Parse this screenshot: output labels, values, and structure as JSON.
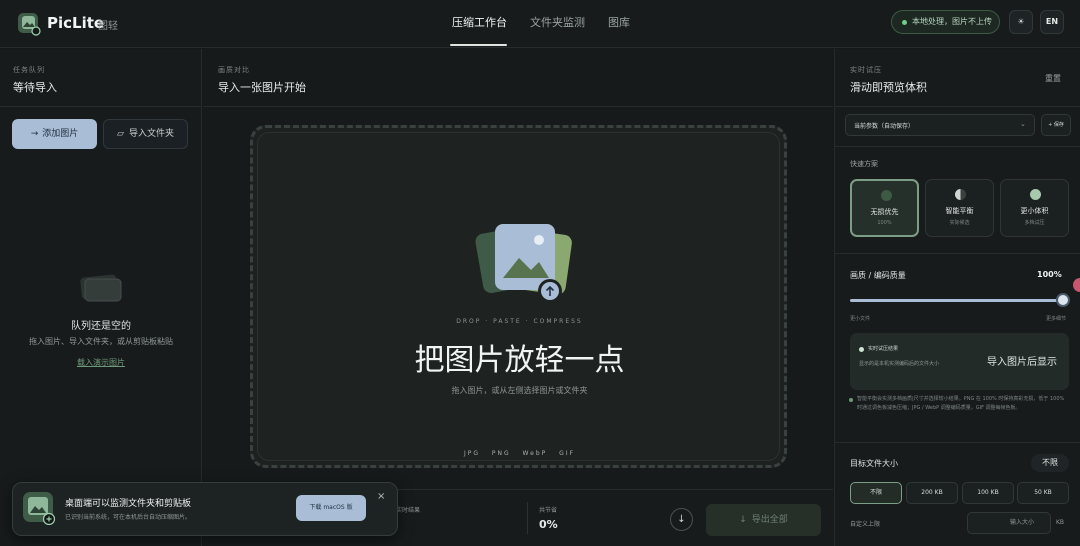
{
  "header": {
    "brand": "PicLite",
    "brand_sub": "图轻",
    "nav": [
      "压缩工作台",
      "文件夹监测",
      "图库"
    ],
    "local_badge": "本地处理，图片不上传",
    "theme_icon": "sun-icon",
    "theme_glyph": "☀",
    "lang": "EN"
  },
  "left": {
    "section_label": "任务队列",
    "title": "等待导入",
    "add_label": "添加图片",
    "folder_label": "导入文件夹",
    "empty_title": "队列还是空的",
    "empty_desc": "拖入图片、导入文件夹，或从剪贴板粘贴",
    "demo_link": "载入演示图片"
  },
  "center": {
    "section_label": "画质对比",
    "title": "导入一张图片开始",
    "drop_caption": "DROP · PASTE · COMPRESS",
    "drop_title": "把图片放轻一点",
    "drop_hint": "拖入图片，或从左侧选择图片或文件夹",
    "formats": "JPG PNG WebP GIF",
    "realtime_result": "实时结果",
    "saved_label": "共节省",
    "saved_value": "0%",
    "export_label": "导出全部"
  },
  "toast": {
    "title": "桌面端可以监测文件夹和剪贴板",
    "desc": "已识别当前系统，可在本机后台自动压缩图片。",
    "button": "下载 macOS 版",
    "close": "×"
  },
  "right": {
    "section_label": "实时试压",
    "title": "滑动即预览体积",
    "reset": "重置",
    "preset_value": "当前参数（自动保存）",
    "save_preset": "+ 保存",
    "quick_label": "快速方案",
    "presets": [
      {
        "title": "无损优先",
        "sub": "100%",
        "color": "#3d5a44"
      },
      {
        "title": "智能平衡",
        "sub": "实际候选",
        "color": "#cfd6d2"
      },
      {
        "title": "更小体积",
        "sub": "多档试压",
        "color": "#a7c9ae"
      }
    ],
    "quality_label": "画质 / 编码质量",
    "quality_value": "100%",
    "quality_fraction": 1.0,
    "slider_min": "更小文件",
    "slider_max": "更多细节",
    "preview_label": "实时试压结果",
    "preview_desc": "显示的是本机实测编码后的文件大小",
    "preview_hint": "导入图片后显示",
    "note": "智能平衡会实测多档画质|尺寸并选择较小结果。PNG 在 100% 时保持真彩无损，低于 100% 时通过调色板减色压缩；JPG / WebP 调整编码质量，GIF 调整每帧色板。",
    "target_label": "目标文件大小",
    "target_value": "不限",
    "targets": [
      "不限",
      "200 KB",
      "100 KB",
      "50 KB"
    ],
    "custom_label": "自定义上限",
    "custom_placeholder": "输入大小",
    "custom_unit": "KB"
  }
}
